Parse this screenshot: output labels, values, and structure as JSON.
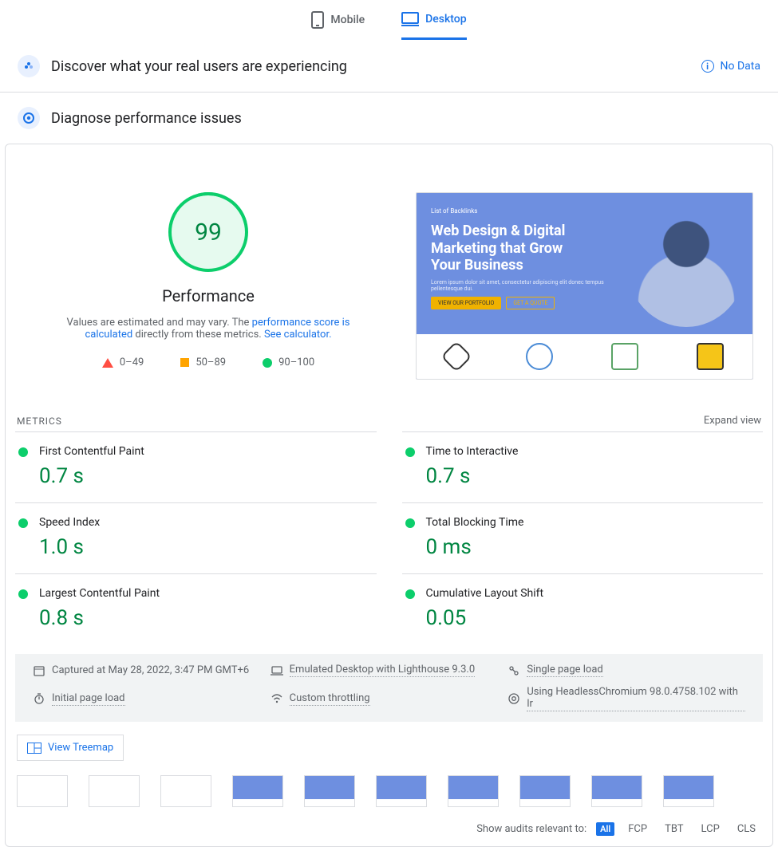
{
  "tabs": {
    "mobile": "Mobile",
    "desktop": "Desktop"
  },
  "crux": {
    "title": "Discover what your real users are experiencing",
    "nodata": "No Data"
  },
  "diag": {
    "title": "Diagnose performance issues"
  },
  "gauge": {
    "score": "99",
    "label": "Performance",
    "blurb_pre": "Values are estimated and may vary. The ",
    "blurb_link1": "performance score is calculated",
    "blurb_mid": " directly from these metrics. ",
    "blurb_link2": "See calculator."
  },
  "legend": {
    "low": "0–49",
    "mid": "50–89",
    "high": "90–100"
  },
  "hero": {
    "brand": "List of Backlinks",
    "title": "Web Design & Digital Marketing that Grow Your Business",
    "lorem": "Lorem ipsum dolor sit amet, consectetur adipiscing elit donec tempus pellentesque dui.",
    "cta1": "VIEW OUR PORTFOLIO",
    "cta2": "GET A QUOTE"
  },
  "metrics_head": {
    "title": "METRICS",
    "expand": "Expand view"
  },
  "metrics": [
    {
      "name": "First Contentful Paint",
      "value": "0.7 s"
    },
    {
      "name": "Time to Interactive",
      "value": "0.7 s"
    },
    {
      "name": "Speed Index",
      "value": "1.0 s"
    },
    {
      "name": "Total Blocking Time",
      "value": "0 ms"
    },
    {
      "name": "Largest Contentful Paint",
      "value": "0.8 s"
    },
    {
      "name": "Cumulative Layout Shift",
      "value": "0.05"
    }
  ],
  "env": {
    "captured": "Captured at May 28, 2022, 3:47 PM GMT+6",
    "emulated": "Emulated Desktop with Lighthouse 9.3.0",
    "spa": "Single page load",
    "initial": "Initial page load",
    "throttle": "Custom throttling",
    "chrome": "Using HeadlessChromium 98.0.4758.102 with lr"
  },
  "treemap": "View Treemap",
  "footer": {
    "label": "Show audits relevant to:",
    "chips": [
      "All",
      "FCP",
      "TBT",
      "LCP",
      "CLS"
    ]
  },
  "chart_data": {
    "type": "table",
    "title": "Lighthouse Performance Metrics (Desktop)",
    "score": 99,
    "scale": {
      "fail": [
        0,
        49
      ],
      "average": [
        50,
        89
      ],
      "good": [
        90,
        100
      ]
    },
    "metrics": {
      "First Contentful Paint": {
        "value": 0.7,
        "unit": "s",
        "rating": "good"
      },
      "Time to Interactive": {
        "value": 0.7,
        "unit": "s",
        "rating": "good"
      },
      "Speed Index": {
        "value": 1.0,
        "unit": "s",
        "rating": "good"
      },
      "Total Blocking Time": {
        "value": 0,
        "unit": "ms",
        "rating": "good"
      },
      "Largest Contentful Paint": {
        "value": 0.8,
        "unit": "s",
        "rating": "good"
      },
      "Cumulative Layout Shift": {
        "value": 0.05,
        "unit": "",
        "rating": "good"
      }
    }
  }
}
